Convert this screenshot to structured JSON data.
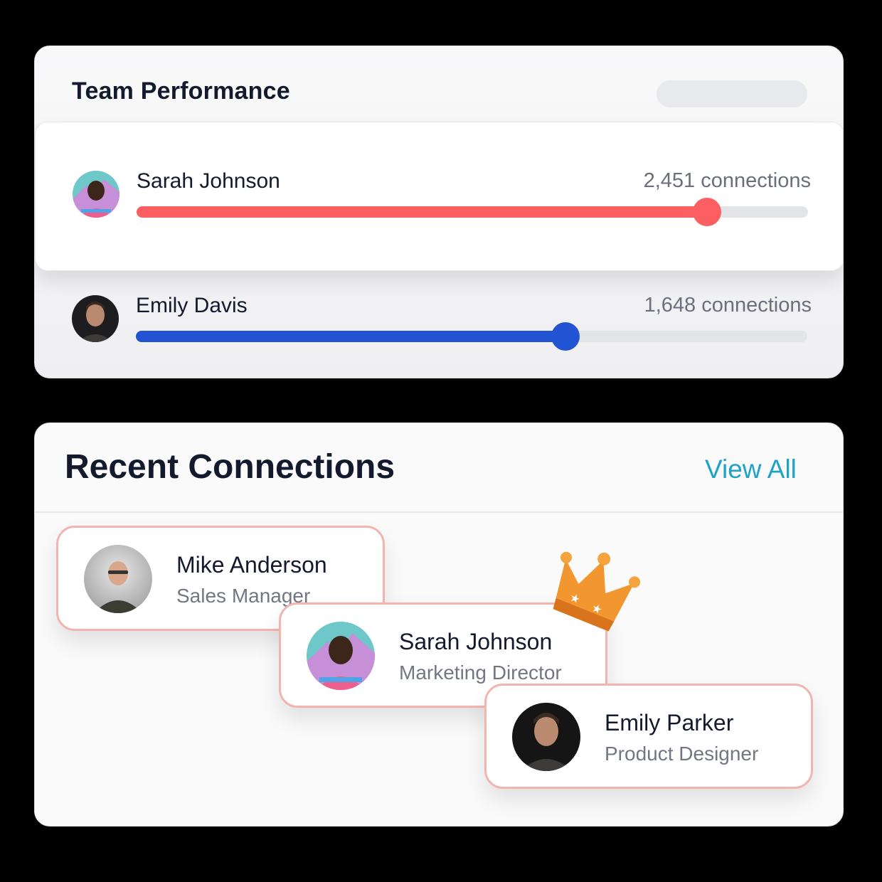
{
  "team_performance": {
    "title": "Team Performance",
    "members": [
      {
        "name": "Sarah Johnson",
        "connections": "2,451 connections",
        "progress": 0.85,
        "color": "#fb5f62"
      },
      {
        "name": "Emily Davis",
        "connections": "1,648 connections",
        "progress": 0.64,
        "color": "#2153d3"
      }
    ]
  },
  "recent_connections": {
    "title": "Recent Connections",
    "view_all": "View All",
    "people": [
      {
        "name": "Mike Anderson",
        "role": "Sales Manager"
      },
      {
        "name": "Sarah Johnson",
        "role": "Marketing Director"
      },
      {
        "name": "Emily Parker",
        "role": "Product Designer"
      }
    ]
  },
  "icons": [
    "avatar-photo",
    "crown-icon"
  ],
  "colors": {
    "accent_red": "#fb5f62",
    "accent_blue": "#2153d3",
    "link": "#1ea3c7",
    "card_border": "#f3b4b0",
    "crown": "#f2962f"
  }
}
